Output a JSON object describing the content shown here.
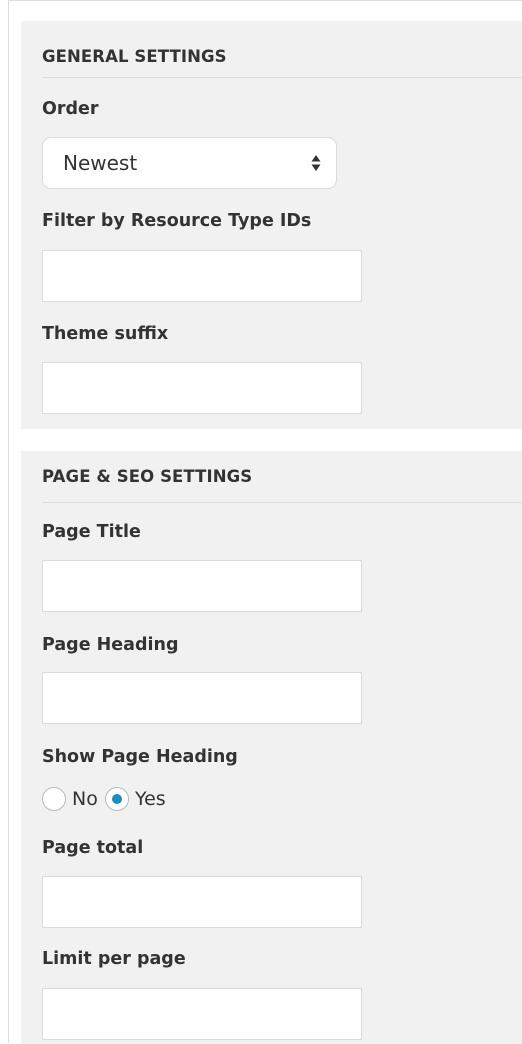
{
  "general_settings": {
    "title": "GENERAL SETTINGS",
    "order": {
      "label": "Order",
      "selected": "Newest"
    },
    "filter_ids": {
      "label": "Filter by Resource Type IDs",
      "value": ""
    },
    "theme_suffix": {
      "label": "Theme suffix",
      "value": ""
    }
  },
  "page_seo_settings": {
    "title": "PAGE & SEO SETTINGS",
    "page_title": {
      "label": "Page Title",
      "value": ""
    },
    "page_heading": {
      "label": "Page Heading",
      "value": ""
    },
    "show_page_heading": {
      "label": "Show Page Heading",
      "options": [
        "No",
        "Yes"
      ],
      "selected": "Yes"
    },
    "page_total": {
      "label": "Page total",
      "value": ""
    },
    "limit_per_page": {
      "label": "Limit per page",
      "value": ""
    }
  },
  "colors": {
    "panel_bg": "#f1f1f1",
    "radio_checked": "#1e8cbe",
    "text": "#333333"
  }
}
